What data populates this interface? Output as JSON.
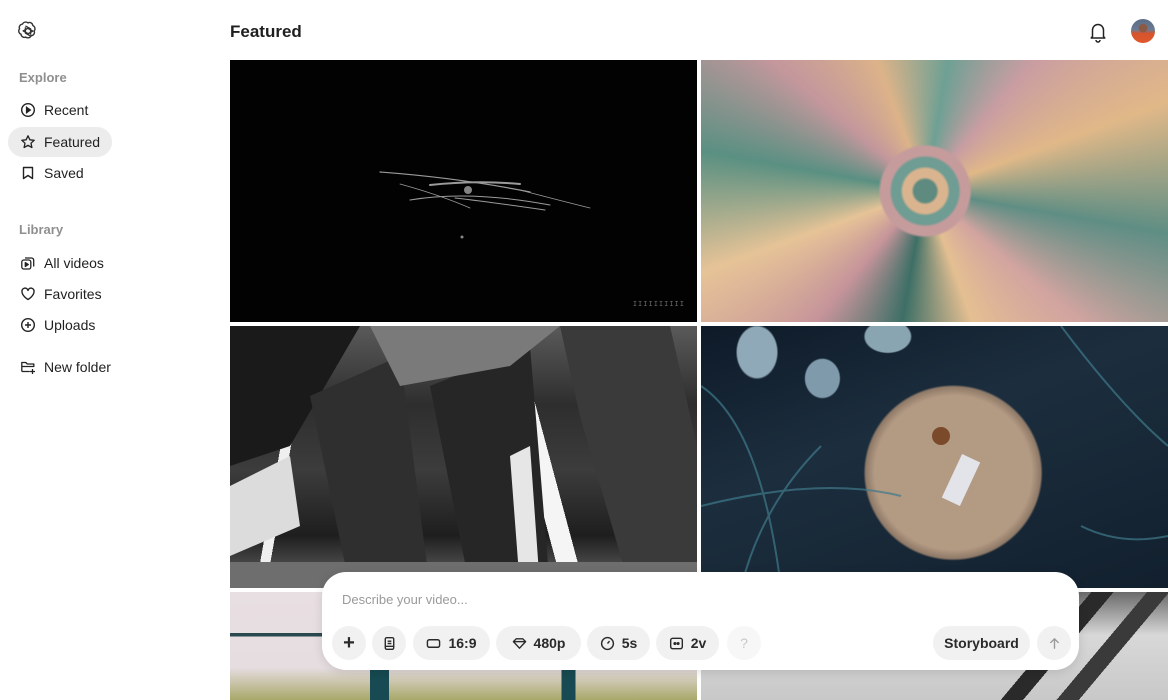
{
  "sidebar": {
    "logo": "openai-logo",
    "sections": {
      "explore_label": "Explore",
      "library_label": "Library"
    },
    "explore_items": [
      {
        "label": "Recent",
        "icon": "play-circle-icon",
        "active": false
      },
      {
        "label": "Featured",
        "icon": "star-icon",
        "active": true
      },
      {
        "label": "Saved",
        "icon": "bookmark-icon",
        "active": false
      }
    ],
    "library_items": [
      {
        "label": "All videos",
        "icon": "videos-icon"
      },
      {
        "label": "Favorites",
        "icon": "heart-icon"
      },
      {
        "label": "Uploads",
        "icon": "plus-circle-icon"
      }
    ],
    "new_folder_label": "New folder"
  },
  "header": {
    "title": "Featured",
    "notifications_icon": "bell-icon",
    "avatar_icon": "user-avatar"
  },
  "grid": {
    "thumbnails": [
      {
        "description": "Dark scene with faint light streaks",
        "watermark": "IIIIIIIIII"
      },
      {
        "description": "Kaleidoscopic folded paper pattern in teal, pink and peach"
      },
      {
        "description": "Monochrome concrete columns and beams"
      },
      {
        "description": "Jellyfish-like creature among dark tendrils"
      },
      {
        "description": "Window frame with teal bars over pale pink"
      },
      {
        "description": "Grey abstract with dark diagonal shapes"
      }
    ]
  },
  "composer": {
    "placeholder": "Describe your video...",
    "value": "",
    "add_label": "+",
    "aspect_ratio": "16:9",
    "resolution": "480p",
    "duration": "5s",
    "variations": "2v",
    "help_label": "?",
    "storyboard_label": "Storyboard"
  }
}
